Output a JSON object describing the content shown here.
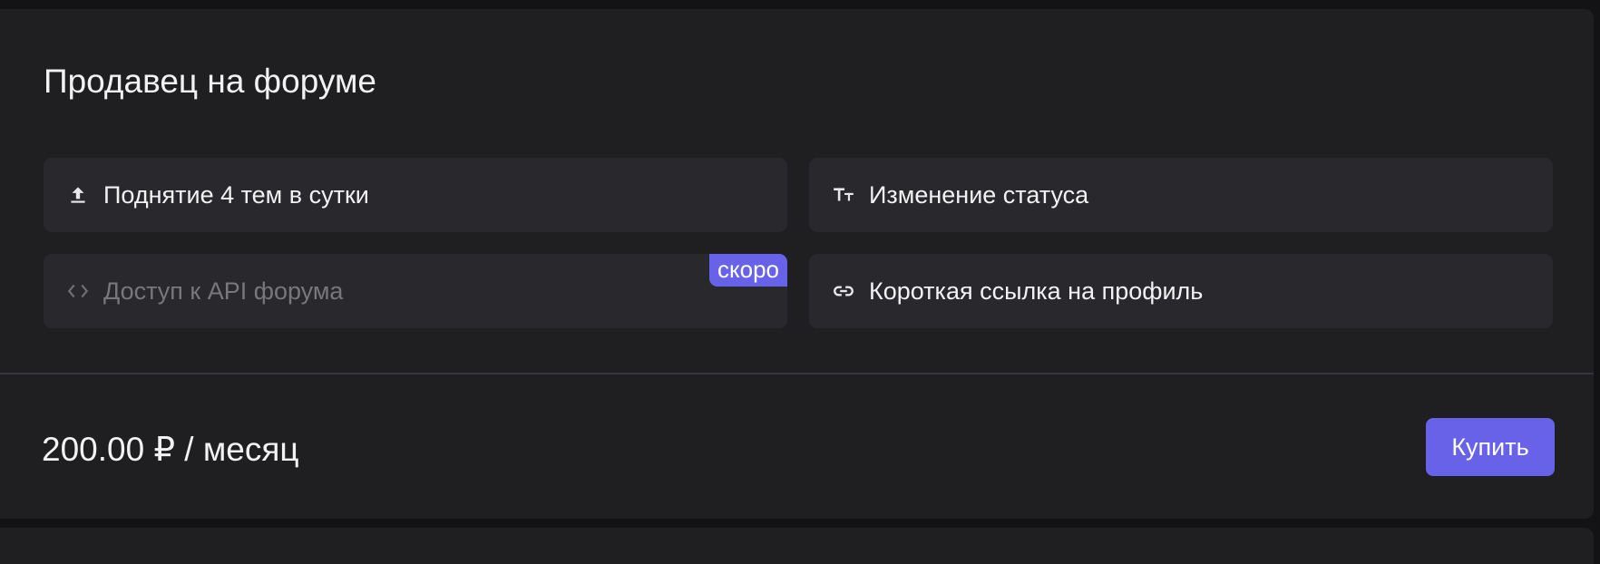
{
  "plan": {
    "title": "Продавец на форуме",
    "features": [
      {
        "label": "Поднятие 4 тем в сутки",
        "icon": "upload-icon",
        "disabled": false
      },
      {
        "label": "Изменение статуса",
        "icon": "text-size-icon",
        "disabled": false
      },
      {
        "label": "Доступ к API форума",
        "icon": "code-icon",
        "disabled": true,
        "badge": "скоро"
      },
      {
        "label": "Короткая ссылка на профиль",
        "icon": "link-icon",
        "disabled": false
      }
    ],
    "price": "200.00 ₽ / месяц",
    "buy_label": "Купить"
  },
  "colors": {
    "accent": "#6762e8",
    "card_bg": "#1f1f22",
    "feature_bg": "#29292d",
    "page_bg": "#131315"
  }
}
